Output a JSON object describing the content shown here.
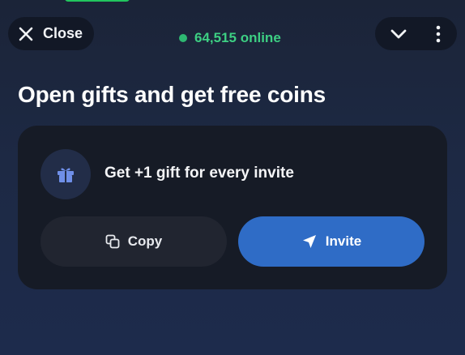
{
  "header": {
    "close_label": "Close",
    "online_text": "64,515 online",
    "online_color": "#3dcf83",
    "close_icon": "close-icon",
    "collapse_icon": "chevron-down-icon",
    "menu_icon": "more-vertical-icon"
  },
  "main": {
    "title": "Open gifts and get free coins"
  },
  "invite_card": {
    "gift_icon": "gift-icon",
    "gift_text": "Get +1 gift for every invite",
    "copy_label": "Copy",
    "copy_icon": "copy-icon",
    "invite_label": "Invite",
    "invite_icon": "send-icon",
    "accent_color": "#2f6cc6"
  }
}
